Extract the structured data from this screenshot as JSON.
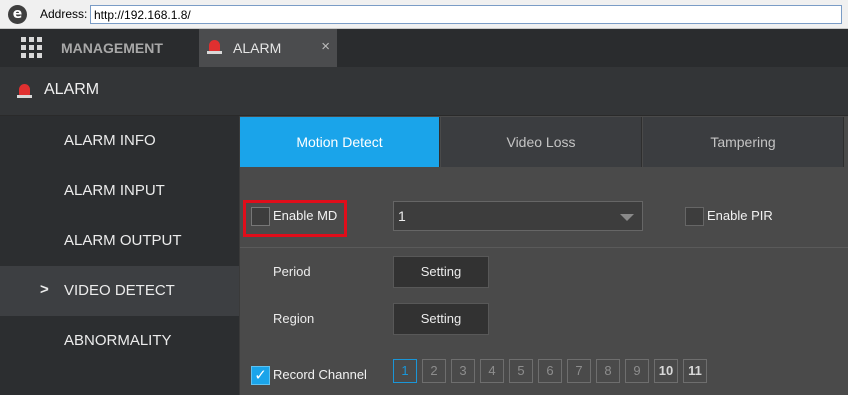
{
  "browser": {
    "logo": "e",
    "address_label": "Address:",
    "url": "http://192.168.1.8/"
  },
  "topnav": {
    "grid_icon": "grid-icon",
    "management_label": "MANAGEMENT",
    "alarm_tab_label": "ALARM",
    "close_glyph": "×"
  },
  "header": {
    "icon": "siren-icon",
    "title": "ALARM"
  },
  "sidebar": {
    "items": [
      {
        "label": "ALARM INFO",
        "active": false
      },
      {
        "label": "ALARM INPUT",
        "active": false
      },
      {
        "label": "ALARM OUTPUT",
        "active": false
      },
      {
        "label": "VIDEO DETECT",
        "active": true
      },
      {
        "label": "ABNORMALITY",
        "active": false
      }
    ],
    "active_marker": ">"
  },
  "tabs": [
    {
      "label": "Motion Detect",
      "active": true
    },
    {
      "label": "Video Loss",
      "active": false
    },
    {
      "label": "Tampering",
      "active": false
    }
  ],
  "form": {
    "enable_md_label": "Enable MD",
    "enable_md_checked": false,
    "channel_select_value": "1",
    "enable_pir_label": "Enable PIR",
    "enable_pir_checked": false,
    "period_label": "Period",
    "period_button": "Setting",
    "region_label": "Region",
    "region_button": "Setting",
    "record_channel_label": "Record Channel",
    "record_channel_checked": true,
    "checkmark": "✓",
    "channels": [
      {
        "label": "1",
        "selected": true
      },
      {
        "label": "2",
        "selected": false
      },
      {
        "label": "3",
        "selected": false
      },
      {
        "label": "4",
        "selected": false
      },
      {
        "label": "5",
        "selected": false
      },
      {
        "label": "6",
        "selected": false
      },
      {
        "label": "7",
        "selected": false
      },
      {
        "label": "8",
        "selected": false
      },
      {
        "label": "9",
        "selected": false
      },
      {
        "label": "10",
        "selected": false
      },
      {
        "label": "11",
        "selected": false
      }
    ]
  },
  "colors": {
    "accent": "#1aa4ea",
    "highlight_box": "#e00d1a"
  }
}
